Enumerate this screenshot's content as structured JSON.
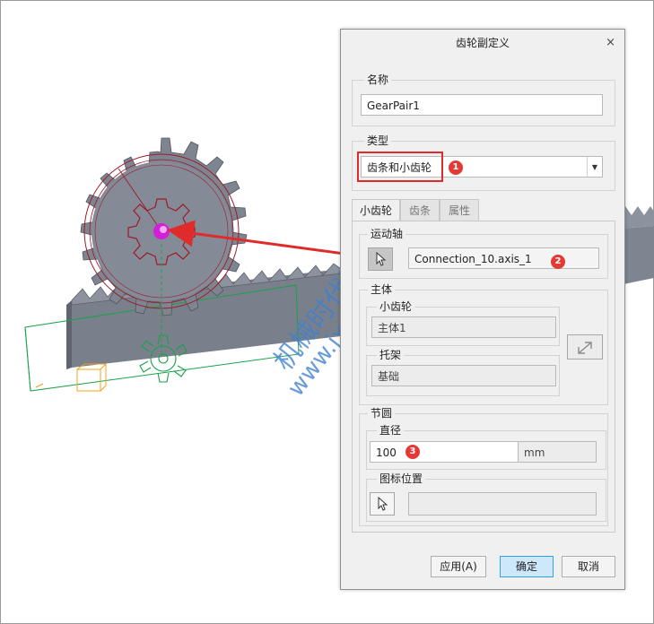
{
  "dialog": {
    "title": "齿轮副定义",
    "close_glyph": "×",
    "name_group": {
      "label": "名称",
      "value": "GearPair1"
    },
    "type_group": {
      "label": "类型",
      "selected": "齿条和小齿轮"
    },
    "tabs": [
      {
        "label": "小齿轮"
      },
      {
        "label": "齿条"
      },
      {
        "label": "属性"
      }
    ],
    "motion_axis": {
      "label": "运动轴",
      "value": "Connection_10.axis_1"
    },
    "body": {
      "label": "主体",
      "pinion": {
        "label": "小齿轮",
        "value": "主体1"
      },
      "carrier": {
        "label": "托架",
        "value": "基础"
      }
    },
    "pitch_circle": {
      "label": "节圆",
      "diameter": {
        "label": "直径",
        "value": "100",
        "unit": "mm"
      },
      "icon_position": {
        "label": "图标位置",
        "value": ""
      }
    },
    "buttons": {
      "apply": "应用(A)",
      "ok": "确定",
      "cancel": "取消"
    }
  },
  "badges": {
    "one": "1",
    "two": "2",
    "three": "3"
  },
  "watermark": {
    "line1": "机械时代网",
    "line2": "www.jxage.com"
  },
  "colors": {
    "callout_red": "#e02b2b",
    "badge_red": "#e53935",
    "gear_gray": "#7e8590",
    "pitch_circle": "#9b1b2a",
    "sketch_green": "#1aa04a",
    "ok_button": "#cde8fb",
    "watermark_blue": "#3f7fd0"
  }
}
